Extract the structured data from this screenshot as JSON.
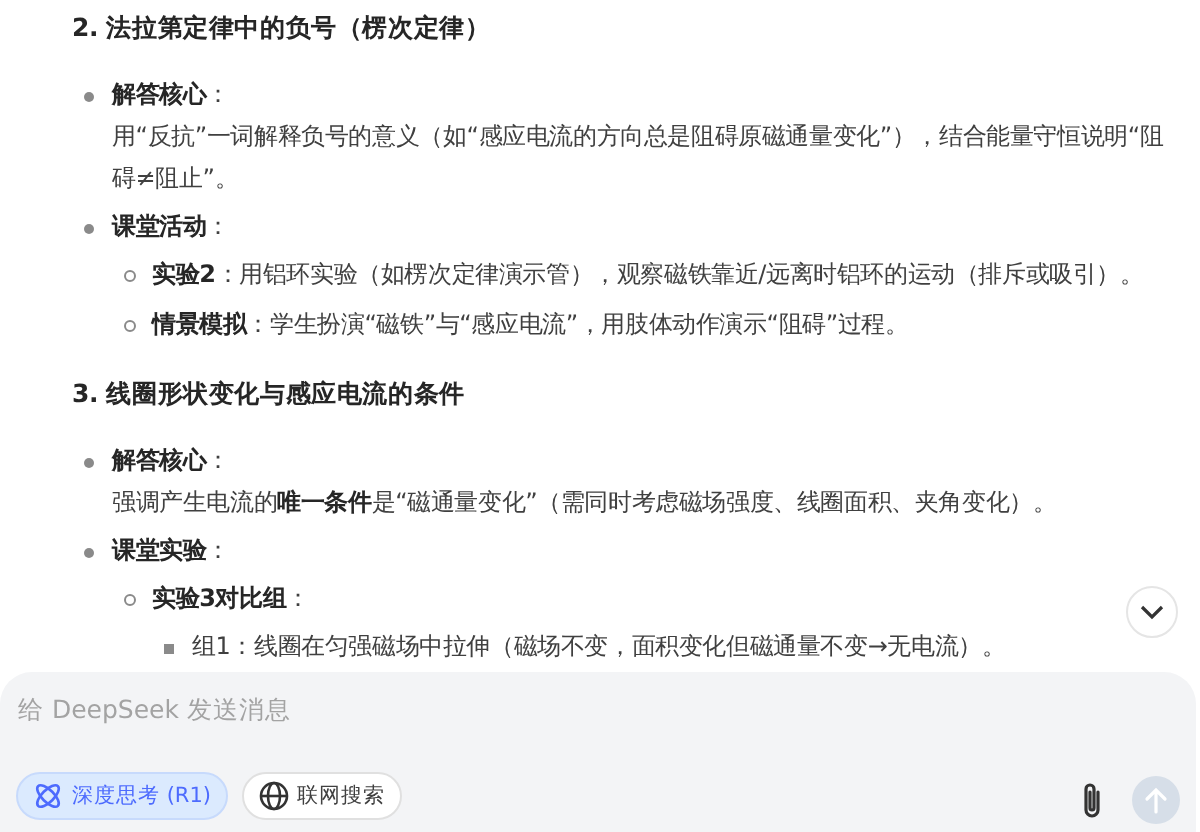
{
  "sections": [
    {
      "heading": "2. 法拉第定律中的负号（楞次定律）",
      "items": [
        {
          "text": "**解答核心**：",
          "body": "用“反抗”一词解释负号的意义（如“感应电流的方向总是阻碍原磁通量变化”），结合能量守恒说明“阻碍≠阻止”。"
        },
        {
          "text": "**课堂活动**：",
          "children": [
            {
              "text": "**实验2**：用铝环实验（如楞次定律演示管），观察磁铁靠近/远离时铝环的运动（排斥或吸引）。"
            },
            {
              "text": "**情景模拟**：学生扮演“磁铁”与“感应电流”，用肢体动作演示“阻碍”过程。"
            }
          ]
        }
      ]
    },
    {
      "heading": "3. 线圈形状变化与感应电流的条件",
      "items": [
        {
          "text": "**解答核心**：",
          "body": "强调产生电流的**唯一条件**是“磁通量变化”（需同时考虑磁场强度、线圈面积、夹角变化）。"
        },
        {
          "text": "**课堂实验**：",
          "children": [
            {
              "text": "**实验3对比组**：",
              "children": [
                {
                  "text": "组1：线圈在匀强磁场中拉伸（磁场不变，面积变化但磁通量不变→无电流）。"
                }
              ]
            }
          ]
        }
      ]
    }
  ],
  "composer": {
    "placeholder": "给 DeepSeek 发送消息",
    "toggles": [
      {
        "label": "深度思考 (R1)",
        "selected": true
      },
      {
        "label": "联网搜索",
        "selected": false
      }
    ],
    "send_disabled": true
  }
}
